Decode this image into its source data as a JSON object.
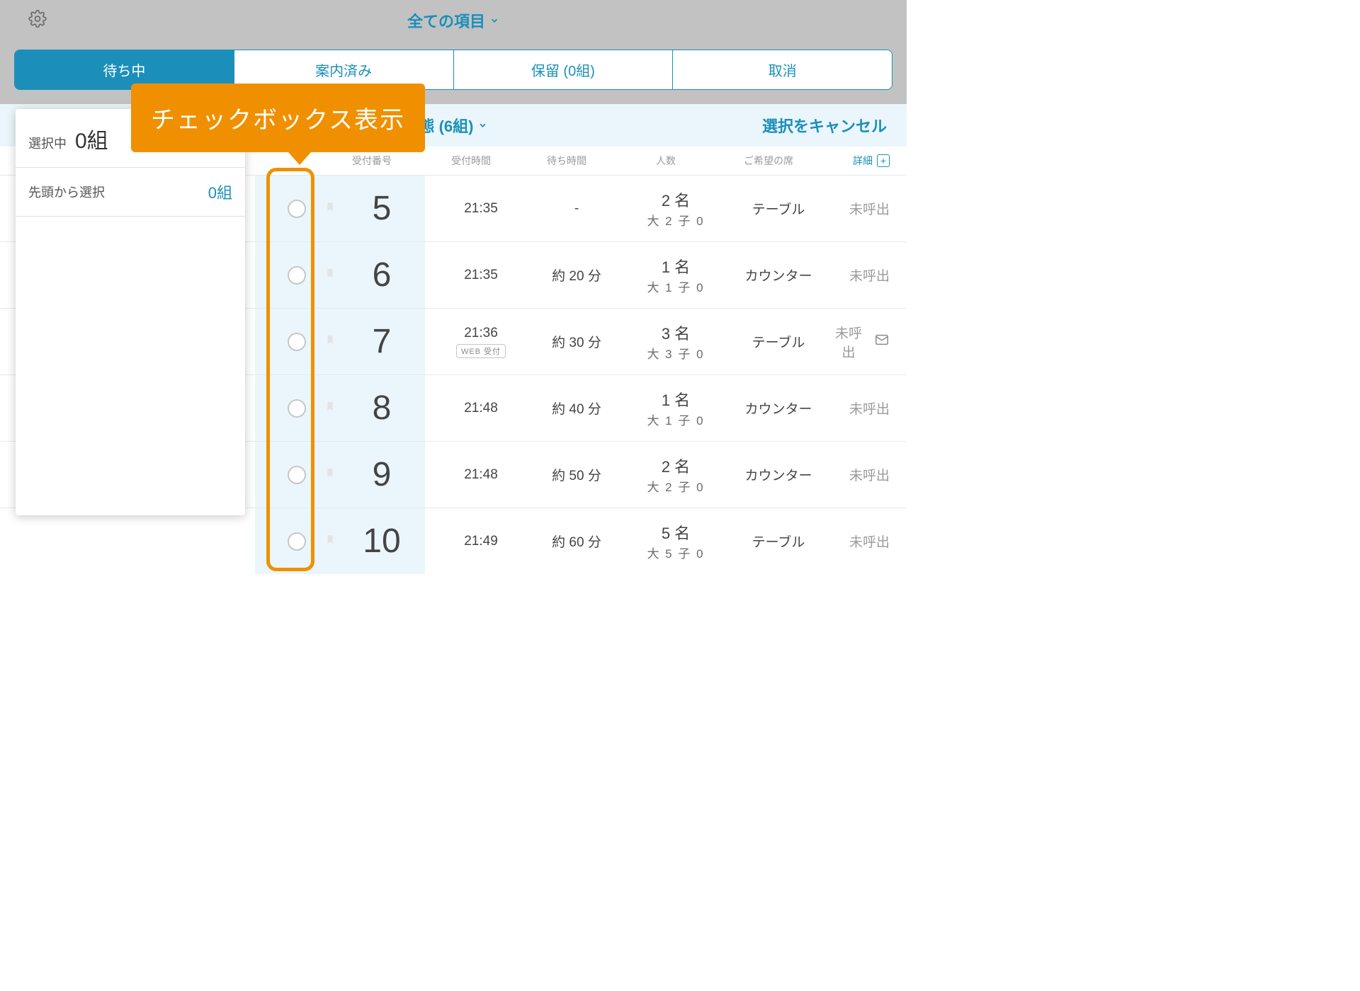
{
  "header": {
    "all_items_label": "全ての項目"
  },
  "tabs": {
    "waiting": "待ち中",
    "done": "案内済み",
    "hold": "保留 (0組)",
    "cancel": "取消"
  },
  "callout": {
    "text": "チェックボックス表示"
  },
  "status_strip": {
    "groups_text": "態 (6組)",
    "cancel_selection": "選択をキャンセル"
  },
  "sel_panel": {
    "selected_label": "選択中",
    "selected_count": "0組",
    "from_top_label": "先頭から選択",
    "from_top_count": "0組"
  },
  "columns": {
    "number": "受付番号",
    "time": "受付時間",
    "wait": "待ち時間",
    "people": "人数",
    "seat": "ご希望の席",
    "detail": "詳細"
  },
  "rows": [
    {
      "num": "5",
      "time": "21:35",
      "web": false,
      "wait": "-",
      "ppl_main": "2 名",
      "ppl_sub": "大 2 子 0",
      "seat": "テーブル",
      "status": "未呼出",
      "mail": false
    },
    {
      "num": "6",
      "time": "21:35",
      "web": false,
      "wait": "約 20 分",
      "ppl_main": "1 名",
      "ppl_sub": "大 1 子 0",
      "seat": "カウンター",
      "status": "未呼出",
      "mail": false
    },
    {
      "num": "7",
      "time": "21:36",
      "web": true,
      "wait": "約 30 分",
      "ppl_main": "3 名",
      "ppl_sub": "大 3 子 0",
      "seat": "テーブル",
      "status": "未呼出",
      "mail": true
    },
    {
      "num": "8",
      "time": "21:48",
      "web": false,
      "wait": "約 40 分",
      "ppl_main": "1 名",
      "ppl_sub": "大 1 子 0",
      "seat": "カウンター",
      "status": "未呼出",
      "mail": false
    },
    {
      "num": "9",
      "time": "21:48",
      "web": false,
      "wait": "約 50 分",
      "ppl_main": "2 名",
      "ppl_sub": "大 2 子 0",
      "seat": "カウンター",
      "status": "未呼出",
      "mail": false
    },
    {
      "num": "10",
      "time": "21:49",
      "web": false,
      "wait": "約 60 分",
      "ppl_main": "5 名",
      "ppl_sub": "大 5 子 0",
      "seat": "テーブル",
      "status": "未呼出",
      "mail": false
    }
  ],
  "web_badge_label": "WEB 受付"
}
